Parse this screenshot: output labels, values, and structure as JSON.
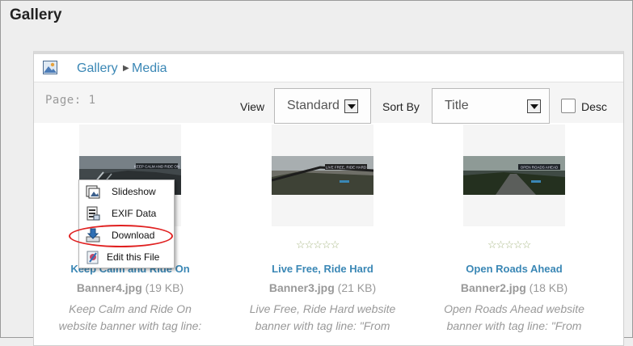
{
  "page": {
    "title": "Gallery"
  },
  "breadcrumb": {
    "items": [
      "Gallery",
      "Media"
    ]
  },
  "toolbar": {
    "page_label": "Page: 1",
    "view_label": "View",
    "view_value": "Standard",
    "sortby_label": "Sort By",
    "sortby_value": "Title",
    "desc_label": "Desc",
    "desc_checked": false
  },
  "items": [
    {
      "title": "Keep Calm and Ride On",
      "file": "Banner4.jpg",
      "size": "(19 KB)",
      "desc1": "Keep Calm and Ride On",
      "desc2": "website banner with tag line:",
      "banner_text": "KEEP CALM AND RIDE ON"
    },
    {
      "title": "Live Free, Ride Hard",
      "file": "Banner3.jpg",
      "size": "(21 KB)",
      "desc1": "Live Free, Ride Hard website",
      "desc2": "banner with tag line: \"From",
      "banner_text": "LIVE FREE, RIDE HARD",
      "rating": 0
    },
    {
      "title": "Open Roads Ahead",
      "file": "Banner2.jpg",
      "size": "(18 KB)",
      "desc1": "Open Roads Ahead website",
      "desc2": "banner with tag line: \"From",
      "banner_text": "OPEN ROADS AHEAD",
      "rating": 0
    }
  ],
  "context_menu": {
    "items": [
      "Slideshow",
      "EXIF Data",
      "Download",
      "Edit this File"
    ],
    "highlighted": "Download"
  },
  "colors": {
    "link": "#3a87b5",
    "highlight_oval": "#e02020"
  }
}
